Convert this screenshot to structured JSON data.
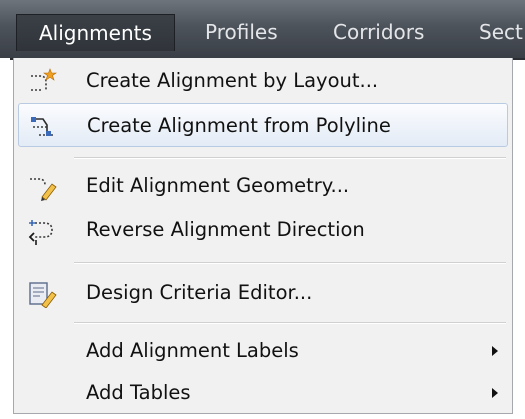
{
  "menubar": {
    "tabs": [
      {
        "label": "Alignments"
      },
      {
        "label": "Profiles"
      },
      {
        "label": "Corridors"
      },
      {
        "label": "Sect"
      }
    ]
  },
  "menu": {
    "items": [
      {
        "label": "Create Alignment by Layout...",
        "icon": "alignment-layout-icon"
      },
      {
        "label": "Create Alignment from Polyline",
        "icon": "alignment-polyline-icon"
      },
      {
        "label": "Edit Alignment Geometry...",
        "icon": "edit-geometry-icon"
      },
      {
        "label": "Reverse Alignment Direction",
        "icon": "reverse-direction-icon"
      },
      {
        "label": "Design Criteria Editor...",
        "icon": "design-criteria-icon"
      },
      {
        "label": "Add Alignment Labels",
        "icon": "submenu-arrow-icon"
      },
      {
        "label": "Add Tables",
        "icon": "submenu-arrow-icon"
      }
    ]
  },
  "colors": {
    "menubar": "#4d535b",
    "menu_bg": "#f1f1f1",
    "hover_border": "#b9cbe3"
  }
}
